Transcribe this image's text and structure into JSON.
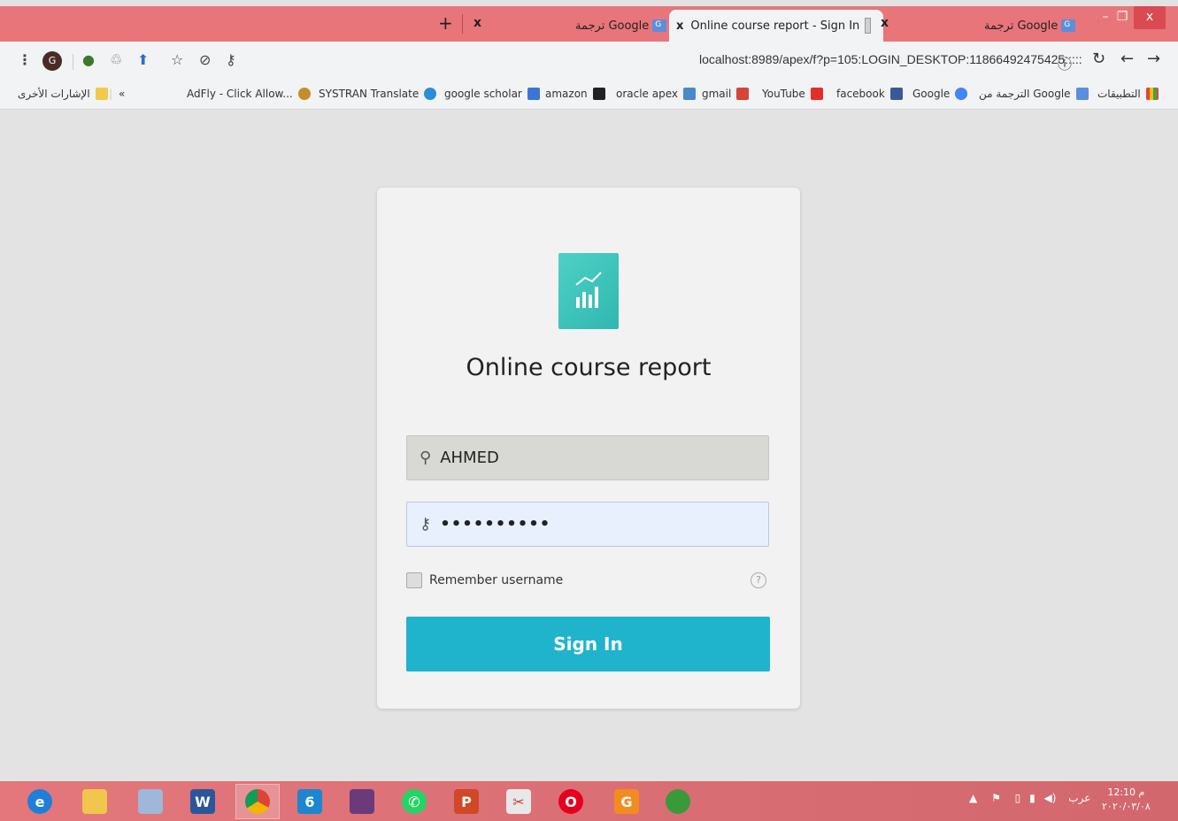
{
  "tabs": [
    {
      "label": "ترجمة Google",
      "active": false
    },
    {
      "label": "Online course report - Sign In",
      "active": true
    },
    {
      "label": "ترجمة Google",
      "active": false
    }
  ],
  "tab_close_glyph": "x",
  "new_tab_glyph": "+",
  "window": {
    "minimize": "–",
    "restore": "❐",
    "close": "x"
  },
  "profile_initial": "G",
  "url": "localhost:8989/apex/f?p=105:LOGIN_DESKTOP:11866492475425:::::",
  "bookmarks": {
    "more": "«",
    "other": "الإشارات الأخرى",
    "apps": "التطبيقات",
    "items": [
      "AdFly - Click Allow...",
      "SYSTRAN Translate",
      "google scholar",
      "amazon",
      "oracle apex",
      "gmail",
      "YouTube",
      "facebook",
      "Google",
      "الترجمة من Google"
    ]
  },
  "login": {
    "title": "Online course report",
    "username": "AHMED",
    "password": "••••••••••",
    "remember_label": "Remember username",
    "remember_checked": false,
    "help": "?",
    "sign_in": "Sign In"
  },
  "taskbar": {
    "apps": [
      "ie",
      "file-explorer",
      "photo-viewer",
      "word",
      "chrome",
      "app-blue",
      "winrar",
      "whatsapp",
      "powerpoint",
      "snipping-tool",
      "opera",
      "pdf-tool",
      "globe-app"
    ],
    "tray_lang": "عرب",
    "time": "12:10 م",
    "date": "٢٠٢٠/٠٣/٠٨"
  },
  "colors": {
    "tab_strip": "#e8757a",
    "card_bg": "#f2f2f2",
    "sign_in": "#1fb3cc",
    "logo": "#3cc3bb",
    "password_field": "#e8f0fe"
  }
}
